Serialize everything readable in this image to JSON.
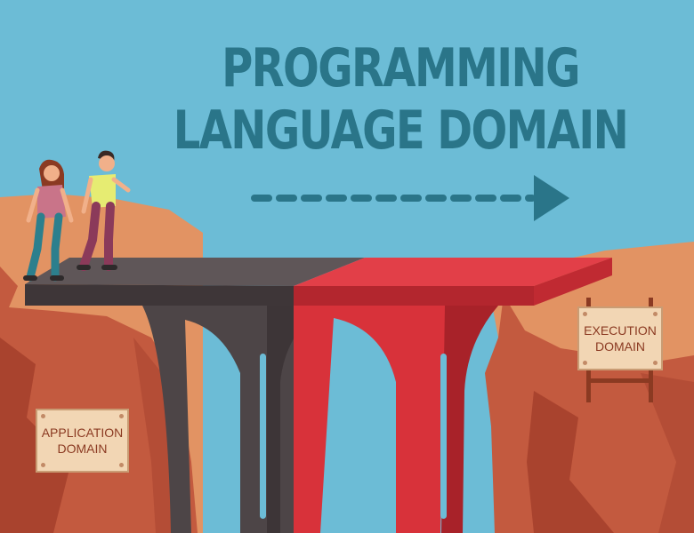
{
  "title": {
    "line1": "PROGRAMMING",
    "line2": "LANGUAGE DOMAIN"
  },
  "signs": {
    "application": {
      "line1": "APPLICATION",
      "line2": "DOMAIN"
    },
    "execution": {
      "line1": "EXECUTION",
      "line2": "DOMAIN"
    }
  },
  "colors": {
    "sky": "#6cbcd6",
    "title": "#2a7589",
    "arrow": "#2a7589",
    "cliff": "#c8573f",
    "bridge_dark": "#4d4547",
    "bridge_red": "#d8323a",
    "sign": "#f2d6b4"
  },
  "icons": {
    "arrow": "dashed-arrow-right-icon"
  }
}
